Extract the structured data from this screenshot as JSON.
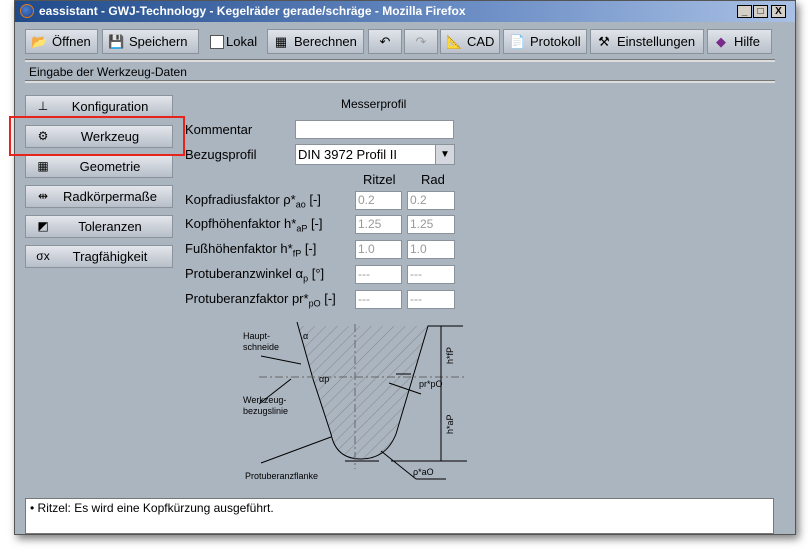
{
  "window": {
    "title": "eassistant - GWJ-Technology - Kegelräder gerade/schräge - Mozilla Firefox",
    "controls": [
      "_",
      "□",
      "X"
    ]
  },
  "toolbar": {
    "open": "Öffnen",
    "save": "Speichern",
    "local": "Lokal",
    "local_checked": false,
    "calculate": "Berechnen",
    "undo": "↶",
    "redo": "↷",
    "cad": "CAD",
    "protocol": "Protokoll",
    "settings": "Einstellungen",
    "help": "Hilfe"
  },
  "section_title": "Eingabe der Werkzeug-Daten",
  "sidebar": {
    "items": [
      {
        "label": "Konfiguration",
        "icon": "configuration-icon"
      },
      {
        "label": "Werkzeug",
        "icon": "gear-tool-icon",
        "highlighted": true
      },
      {
        "label": "Geometrie",
        "icon": "grid-icon"
      },
      {
        "label": "Radkörpermaße",
        "icon": "dimension-icon"
      },
      {
        "label": "Toleranzen",
        "icon": "tolerance-icon"
      },
      {
        "label": "Tragfähigkeit",
        "icon": "sigma-icon"
      }
    ],
    "highlight_color": "#e8231c"
  },
  "form": {
    "heading": "Messerprofil",
    "comment_label": "Kommentar",
    "comment_value": "",
    "profile_label": "Bezugsprofil",
    "profile_value": "DIN 3972 Profil II",
    "col_pinion": "Ritzel",
    "col_gear": "Rad",
    "rows": [
      {
        "label": "Kopfradiusfaktor ρ*",
        "sub": "ao",
        "unit": " [-]",
        "pinion": "0.2",
        "gear": "0.2"
      },
      {
        "label": "Kopfhöhenfaktor h*",
        "sub": "aP",
        "unit": " [-]",
        "pinion": "1.25",
        "gear": "1.25"
      },
      {
        "label": "Fußhöhenfaktor h*",
        "sub": "fP",
        "unit": " [-]",
        "pinion": "1.0",
        "gear": "1.0"
      },
      {
        "label": "Protuberanzwinkel α",
        "sub": "p",
        "unit": " [°]",
        "pinion": "---",
        "gear": "---"
      },
      {
        "label": "Protuberanzfaktor pr*",
        "sub": "pO",
        "unit": " [-]",
        "pinion": "---",
        "gear": "---"
      }
    ]
  },
  "diagram": {
    "haupt": "Haupt-",
    "schneide": "schneide",
    "alpha": "α",
    "alpha_p": "αp",
    "werkzeug": "Werkzeug-",
    "bezugslinie": "bezugslinie",
    "protuberanz": "Protuberanzflanke",
    "hfp": "h*fP",
    "hap": "h*aP",
    "prpo": "pr*pO",
    "rho": "ρ*aO"
  },
  "message": "• Ritzel: Es wird eine Kopfkürzung ausgeführt."
}
